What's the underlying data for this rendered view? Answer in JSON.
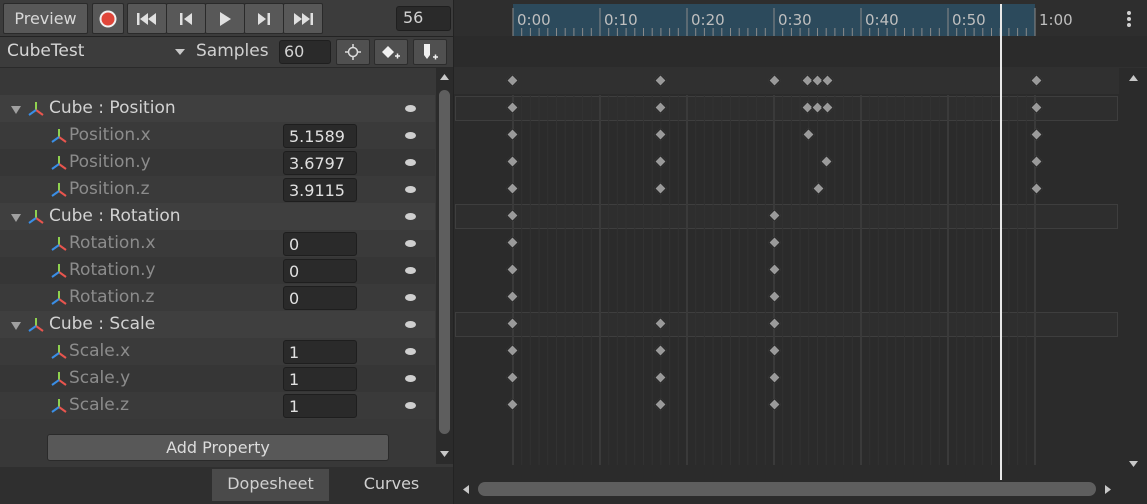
{
  "toolbar": {
    "preview_label": "Preview",
    "frame_value": "56"
  },
  "clip": {
    "name": "CubeTest",
    "samples_label": "Samples",
    "samples_value": "60"
  },
  "properties": [
    {
      "type": "group",
      "label": "Cube : Position"
    },
    {
      "type": "prop",
      "label": "Position.x",
      "value": "5.1589"
    },
    {
      "type": "prop",
      "label": "Position.y",
      "value": "3.6797"
    },
    {
      "type": "prop",
      "label": "Position.z",
      "value": "3.9115"
    },
    {
      "type": "group",
      "label": "Cube : Rotation"
    },
    {
      "type": "prop",
      "label": "Rotation.x",
      "value": "0"
    },
    {
      "type": "prop",
      "label": "Rotation.y",
      "value": "0"
    },
    {
      "type": "prop",
      "label": "Rotation.z",
      "value": "0"
    },
    {
      "type": "group",
      "label": "Cube : Scale"
    },
    {
      "type": "prop",
      "label": "Scale.x",
      "value": "1"
    },
    {
      "type": "prop",
      "label": "Scale.y",
      "value": "1"
    },
    {
      "type": "prop",
      "label": "Scale.z",
      "value": "1"
    }
  ],
  "add_property_label": "Add Property",
  "tabs": {
    "dopesheet": "Dopesheet",
    "curves": "Curves"
  },
  "ruler": {
    "labels": [
      "0:00",
      "0:10",
      "0:20",
      "0:30",
      "0:40",
      "0:50",
      "1:00"
    ]
  },
  "colors": {
    "record": "#e0463a",
    "selection": "#2c4a5c"
  }
}
